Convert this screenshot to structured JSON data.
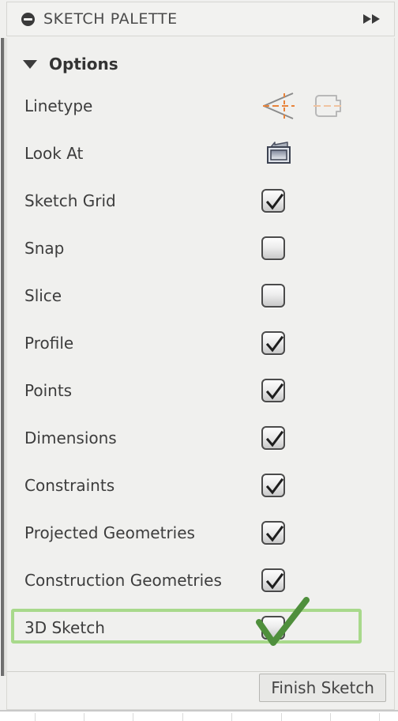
{
  "titlebar": {
    "collapse_icon": "minus-circle-icon",
    "title": "SKETCH PALETTE",
    "expand_icon": "double-chevron-right-icon"
  },
  "options_section": {
    "disclosure_icon": "triangle-down-icon",
    "label": "Options",
    "expanded": true
  },
  "rows": [
    {
      "label": "Linetype",
      "control": "icons",
      "icons": [
        "centerline-icon",
        "construction-geometry-icon"
      ],
      "disabled_icon_index": 1
    },
    {
      "label": "Look At",
      "control": "icon",
      "icons": [
        "look-at-icon"
      ]
    },
    {
      "label": "Sketch Grid",
      "control": "checkbox",
      "checked": true
    },
    {
      "label": "Snap",
      "control": "checkbox",
      "checked": false
    },
    {
      "label": "Slice",
      "control": "checkbox",
      "checked": false
    },
    {
      "label": "Profile",
      "control": "checkbox",
      "checked": true
    },
    {
      "label": "Points",
      "control": "checkbox",
      "checked": true
    },
    {
      "label": "Dimensions",
      "control": "checkbox",
      "checked": true
    },
    {
      "label": "Constraints",
      "control": "checkbox",
      "checked": true
    },
    {
      "label": "Projected Geometries",
      "control": "checkbox",
      "checked": true
    },
    {
      "label": "Construction Geometries",
      "control": "checkbox",
      "checked": true
    },
    {
      "label": "3D Sketch",
      "control": "checkbox",
      "checked": false,
      "highlighted": true
    }
  ],
  "annotation": {
    "highlight_target": "3D Sketch",
    "highlight_color": "#a8d98b",
    "check_mark_color": "#4f8f3c",
    "check_mark_icon": "green-check-annotation-icon"
  },
  "footer": {
    "finish_button_label": "Finish Sketch"
  },
  "colors": {
    "panel_background": "#f0f0ee",
    "titlebar_background": "#f2f2f0",
    "text": "#3d3d3d",
    "accent_orange": "#e8833a",
    "disabled_gray": "#b8b8b8"
  }
}
